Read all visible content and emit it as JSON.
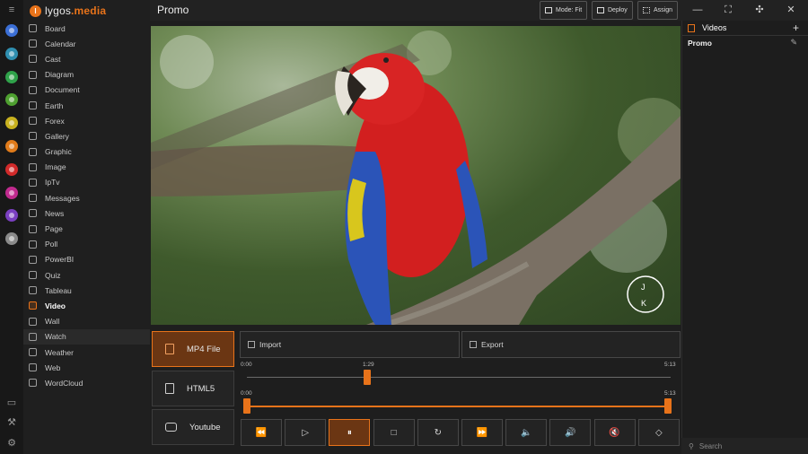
{
  "brand": {
    "name_prefix": "lygos",
    "name_suffix": ".media",
    "logo_letter": "l"
  },
  "window": {
    "title": "Promo"
  },
  "toolbar": {
    "mode_label": "Mode: Fit",
    "deploy_label": "Deploy",
    "assign_label": "Assign"
  },
  "sidebar": {
    "items": [
      {
        "label": "Board"
      },
      {
        "label": "Calendar"
      },
      {
        "label": "Cast"
      },
      {
        "label": "Diagram"
      },
      {
        "label": "Document"
      },
      {
        "label": "Earth"
      },
      {
        "label": "Forex"
      },
      {
        "label": "Gallery"
      },
      {
        "label": "Graphic"
      },
      {
        "label": "Image"
      },
      {
        "label": "IpTv"
      },
      {
        "label": "Messages"
      },
      {
        "label": "News"
      },
      {
        "label": "Page"
      },
      {
        "label": "Poll"
      },
      {
        "label": "PowerBI"
      },
      {
        "label": "Quiz"
      },
      {
        "label": "Tableau"
      },
      {
        "label": "Video"
      },
      {
        "label": "Wall"
      },
      {
        "label": "Watch"
      },
      {
        "label": "Weather"
      },
      {
        "label": "Web"
      },
      {
        "label": "WordCloud"
      }
    ],
    "active_index": 18,
    "hover_index": 20
  },
  "rail_colors": [
    "#3b6fd6",
    "#2f8fb0",
    "#2fa24a",
    "#4ea030",
    "#c9b21f",
    "#e07b1a",
    "#d12a2a",
    "#c02a8e",
    "#7a3fc0",
    "#8a8a8a"
  ],
  "sources": [
    {
      "label": "MP4 File",
      "icon": "file-video-icon"
    },
    {
      "label": "HTML5",
      "icon": "html5-icon"
    },
    {
      "label": "Youtube",
      "icon": "youtube-icon"
    }
  ],
  "actions": {
    "import_label": "Import",
    "export_label": "Export"
  },
  "timeline": {
    "position_start": "0:00",
    "position_current": "1:29",
    "position_end": "5:13",
    "position_fraction": 0.284,
    "trim_start": "0:00",
    "trim_end": "5:13"
  },
  "controls": [
    {
      "name": "rewind-button",
      "glyph": "⏪"
    },
    {
      "name": "play-button",
      "glyph": "▷"
    },
    {
      "name": "pause-button",
      "glyph": "⏸"
    },
    {
      "name": "stop-button",
      "glyph": "□"
    },
    {
      "name": "replay-button",
      "glyph": "↻"
    },
    {
      "name": "fast-forward-button",
      "glyph": "⏩"
    },
    {
      "name": "volume-down-button",
      "glyph": "🔈"
    },
    {
      "name": "volume-up-button",
      "glyph": "🔊"
    },
    {
      "name": "mute-button",
      "glyph": "🔇"
    },
    {
      "name": "tag-button",
      "glyph": "◇"
    }
  ],
  "right_panel": {
    "header": "Videos",
    "items": [
      {
        "label": "Promo"
      }
    ]
  },
  "search": {
    "placeholder": "Search"
  },
  "watermark": {
    "letters": [
      "J",
      "K"
    ]
  },
  "colors": {
    "accent": "#e8731a",
    "active_bg": "#6b3613"
  }
}
